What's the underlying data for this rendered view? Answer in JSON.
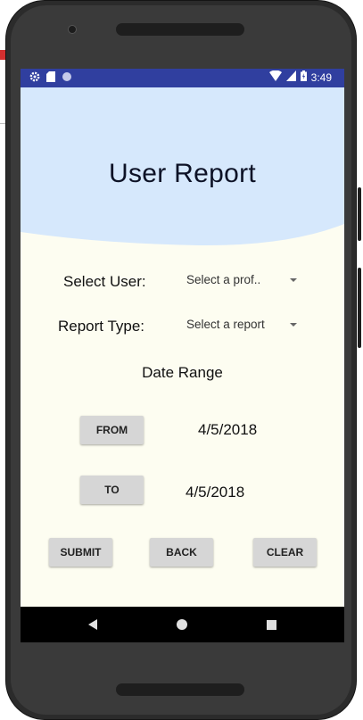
{
  "status_bar": {
    "time": "3:49",
    "left_icons": [
      "settings-icon",
      "sd-card-icon",
      "circle-icon"
    ],
    "right_icons": [
      "wifi-icon",
      "cell-signal-icon",
      "battery-icon"
    ],
    "background_color": "#303f9f"
  },
  "header": {
    "title": "User Report",
    "background_color": "#d6e8fc"
  },
  "form": {
    "select_user_label": "Select User:",
    "select_user_value": "Select a prof..",
    "report_type_label": "Report Type:",
    "report_type_value": "Select a report",
    "date_range_label": "Date Range",
    "from_button": "FROM",
    "from_date": "4/5/2018",
    "to_button": "TO",
    "to_date": "4/5/2018"
  },
  "actions": {
    "submit": "SUBMIT",
    "back": "BACK",
    "clear": "CLEAR"
  },
  "nav_bar": {
    "icons": [
      "back-icon",
      "home-icon",
      "recents-icon"
    ]
  },
  "colors": {
    "screen_background": "#fdfdf1",
    "button_background": "#d6d6d6"
  }
}
